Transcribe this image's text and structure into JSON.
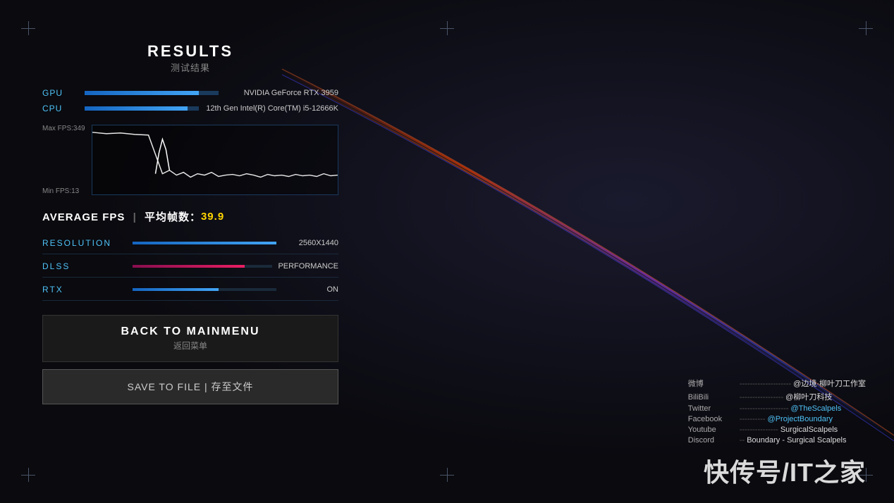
{
  "background": {
    "color": "#0a0a0f"
  },
  "results": {
    "title_main": "RESULTS",
    "title_sub": "测试结果",
    "gpu_label": "GPU",
    "gpu_value": "NVIDIA GeForce RTX 3959",
    "cpu_label": "CPU",
    "cpu_value": "12th Gen Intel(R) Core(TM) i5-12666K",
    "graph": {
      "max_fps_label": "Max FPS:349",
      "min_fps_label": "Min FPS:13"
    },
    "avg_fps_label": "AVERAGE FPS",
    "avg_fps_separator": "|",
    "avg_fps_label_cn": "平均帧数：",
    "avg_fps_value": "39.9",
    "resolution_label": "RESOLUTION",
    "resolution_value": "2560X1440",
    "dlss_label": "DLSS",
    "dlss_value": "PERFORMANCE",
    "rtx_label": "RTX",
    "rtx_value": "ON",
    "btn_back_main": "BACK TO MAINMENU",
    "btn_back_sub": "返回菜单",
    "btn_save": "SAVE TO FILE | 存至文件"
  },
  "social": {
    "weibo_platform": "微博",
    "weibo_divider": "--------------------",
    "weibo_handle": "@边境·柳叶刀工作室",
    "bilibili_platform": "BiliBili",
    "bilibili_divider": "-----------------",
    "bilibili_handle": "@柳叶刀科技",
    "twitter_platform": "Twitter",
    "twitter_divider": "-------------------",
    "twitter_handle": "@TheScalpels",
    "facebook_platform": "Facebook",
    "facebook_divider": "----------",
    "facebook_handle": "@ProjectBoundary",
    "youtube_platform": "Youtube",
    "youtube_divider": "---------------",
    "youtube_handle": "SurgicalScalpels",
    "discord_platform": "Discord",
    "discord_divider": "--",
    "discord_handle": "Boundary - Surgical Scalpels"
  },
  "watermark": "快传号/IT之家"
}
